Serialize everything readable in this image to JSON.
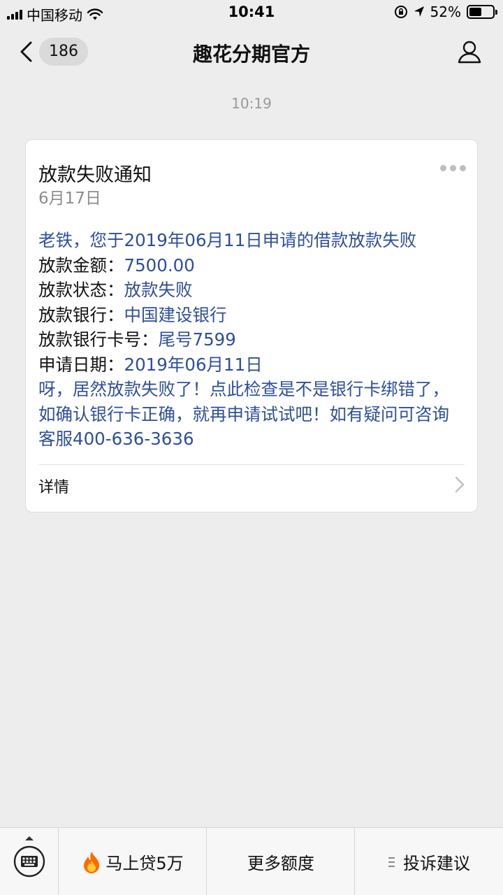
{
  "status_bar": {
    "carrier": "中国移动",
    "time": "10:41",
    "battery_percent": "52%",
    "battery_level": 0.52,
    "icons": [
      "signal-icon",
      "wifi-icon",
      "orientation-lock-icon",
      "location-icon",
      "battery-icon"
    ]
  },
  "nav": {
    "back_count": "186",
    "title": "趣花分期官方",
    "icons": [
      "chevron-left-icon",
      "profile-icon"
    ]
  },
  "chat": {
    "timestamp": "10:19"
  },
  "card": {
    "title": "放款失败通知",
    "date": "6月17日",
    "greeting": "老铁，您于2019年06月11日申请的借款放款失败",
    "rows": [
      {
        "label": "放款金额：",
        "value": "7500.00"
      },
      {
        "label": "放款状态：",
        "value": "放款失败"
      },
      {
        "label": "放款银行：",
        "value": "中国建设银行"
      },
      {
        "label": "放款银行卡号：",
        "value": "尾号7599"
      },
      {
        "label": "申请日期：",
        "value": "2019年06月11日"
      }
    ],
    "remark": "呀，居然放款失败了！点此检查是不是银行卡绑错了，如确认银行卡正确，就再申请试试吧！如有疑问可咨询客服400-636-3636",
    "detail_label": "详情"
  },
  "bottom_menu": {
    "item1": "马上贷5万",
    "item2": "更多额度",
    "item3": "投诉建议",
    "icons": [
      "keyboard-icon",
      "fire-icon",
      "list-icon"
    ]
  },
  "colors": {
    "background": "#ededed",
    "card_text_blue": "#2d4f9e",
    "fire": "#ff6a00"
  }
}
